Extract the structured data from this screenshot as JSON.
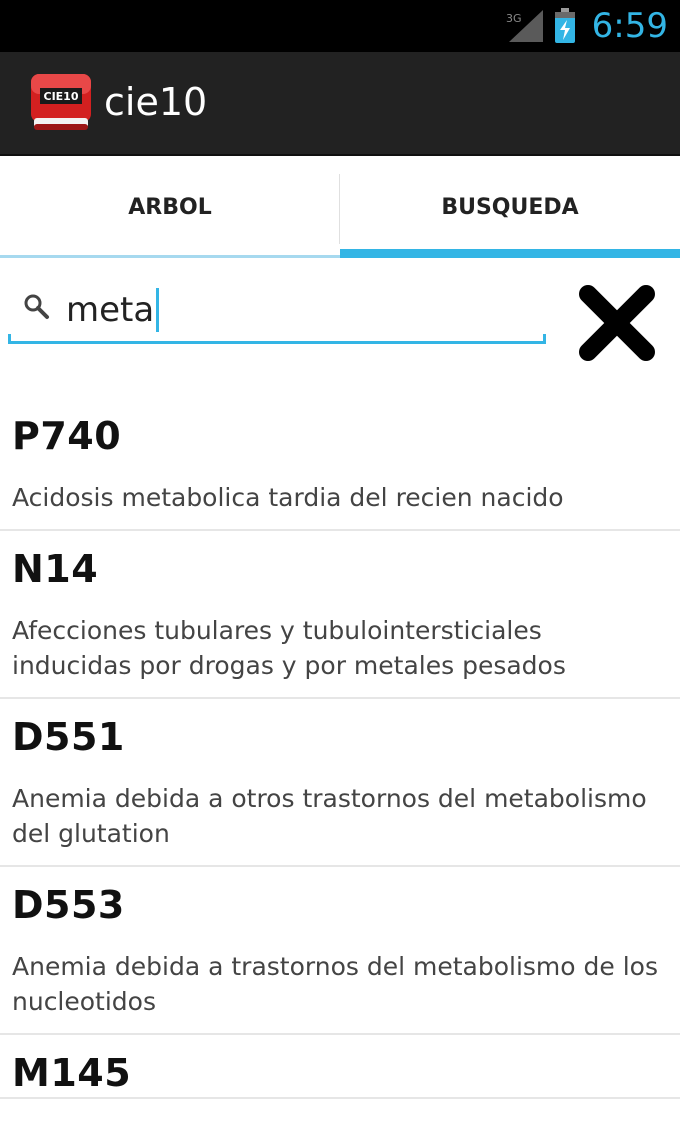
{
  "status": {
    "time": "6:59",
    "network_label": "3G"
  },
  "app": {
    "title": "cie10",
    "icon_text": "CIE10"
  },
  "tabs": [
    {
      "label": "ARBOL",
      "selected": false
    },
    {
      "label": "BUSQUEDA",
      "selected": true
    }
  ],
  "search": {
    "value": "meta"
  },
  "results": [
    {
      "code": "P740",
      "description": "Acidosis metabolica tardia del recien nacido"
    },
    {
      "code": "N14",
      "description": "Afecciones tubulares y tubulointersticiales inducidas por drogas y por metales pesados"
    },
    {
      "code": "D551",
      "description": "Anemia debida a otros trastornos del metabolismo del glutation"
    },
    {
      "code": "D553",
      "description": "Anemia debida a trastornos del metabolismo de los nucleotidos"
    },
    {
      "code": "M145",
      "description": ""
    }
  ],
  "colors": {
    "accent": "#33b5e5",
    "action_bar": "#222222",
    "status_bar": "#000000",
    "icon_red": "#d32020"
  }
}
